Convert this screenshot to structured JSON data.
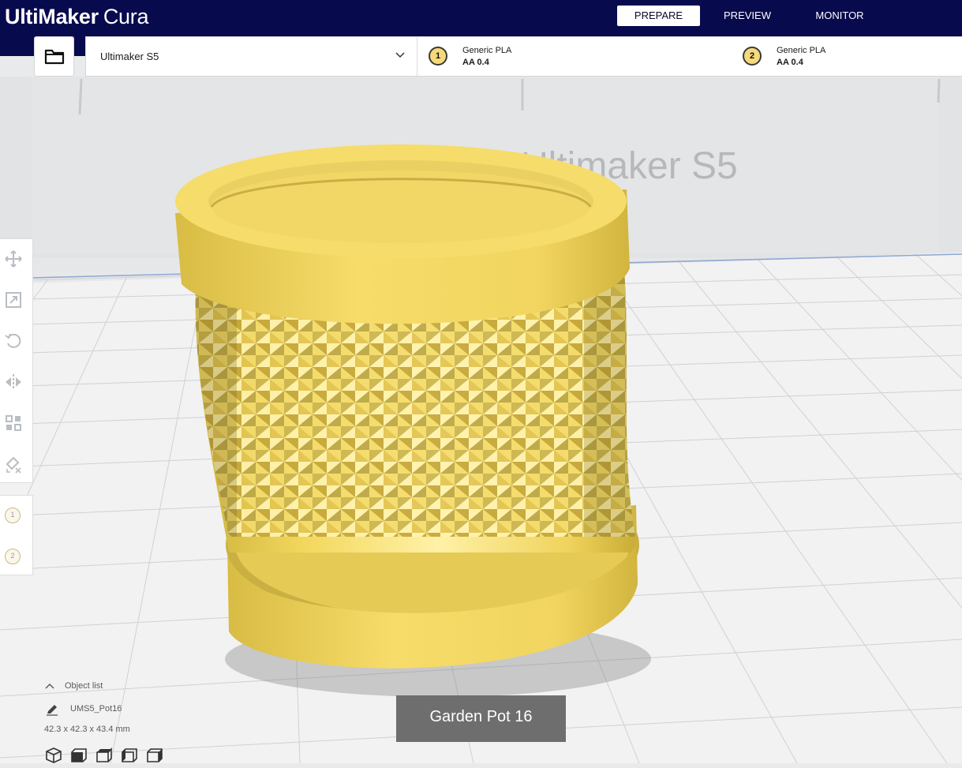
{
  "app": {
    "brand_bold": "UltiMaker",
    "brand_light": "Cura"
  },
  "stages": [
    {
      "label": "PREPARE",
      "active": true
    },
    {
      "label": "PREVIEW",
      "active": false
    },
    {
      "label": "MONITOR",
      "active": false
    }
  ],
  "machine": {
    "printer": "Ultimaker S5"
  },
  "extruders": [
    {
      "index": "1",
      "material": "Generic PLA",
      "nozzle": "AA 0.4",
      "color": "#f5d97a"
    },
    {
      "index": "2",
      "material": "Generic PLA",
      "nozzle": "AA 0.4",
      "color": "#f5d97a"
    }
  ],
  "viewport": {
    "build_plate_label": "Ultimaker S5",
    "model_color": "#f7dd6a"
  },
  "toolbar": {
    "tools": [
      "move-icon",
      "scale-icon",
      "rotate-icon",
      "mirror-icon",
      "per-model-settings-icon",
      "support-blocker-icon"
    ],
    "extruder_buttons": [
      "1",
      "2"
    ]
  },
  "object_list": {
    "title": "Object list",
    "object_name": "UMS5_Pot16",
    "dimensions": "42.3 x 42.3 x 43.4 mm",
    "view_buttons": [
      "3d-view-icon",
      "front-view-icon",
      "top-view-icon",
      "left-view-icon",
      "right-view-icon"
    ]
  },
  "tooltip": {
    "text": "Garden Pot 16"
  }
}
